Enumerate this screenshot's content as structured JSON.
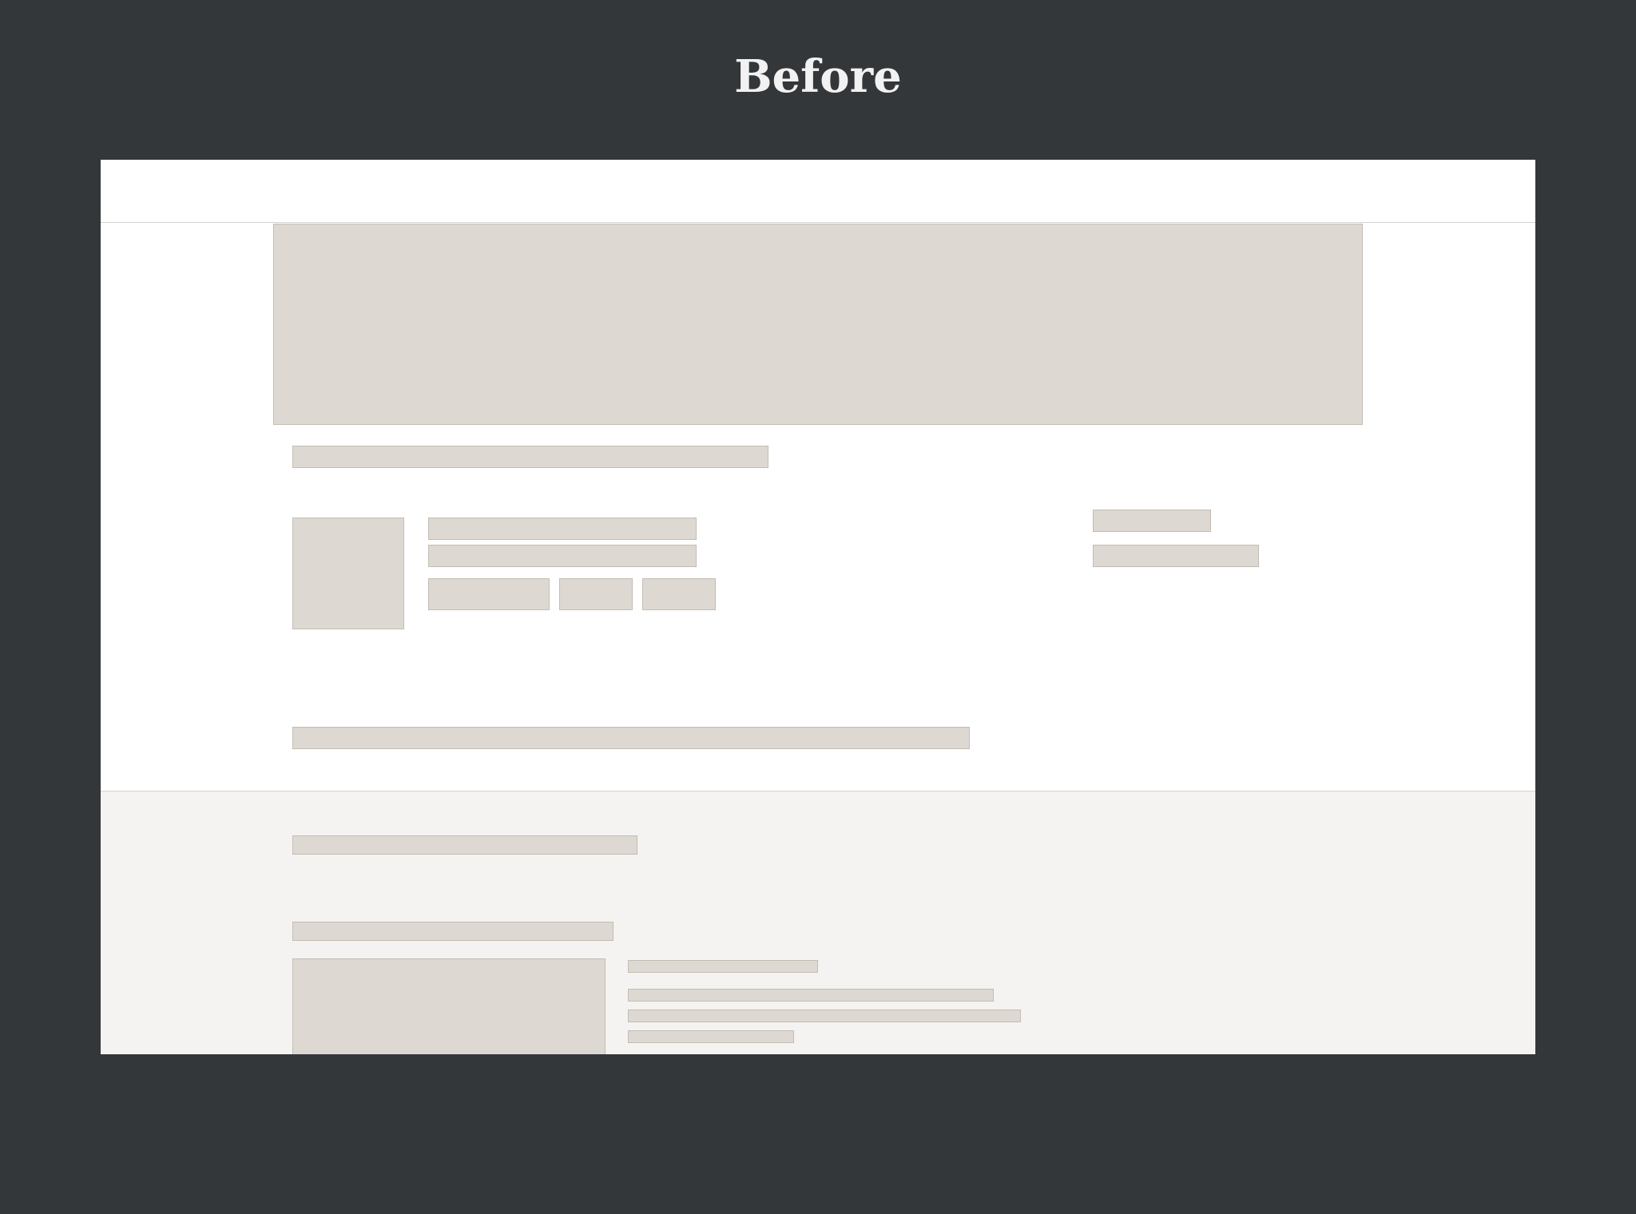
{
  "heading": "Before",
  "colors": {
    "backdrop": "#34373a",
    "page": "#ffffff",
    "lower_section": "#f4f3f1",
    "placeholder_fill": "#ddd8d1",
    "placeholder_border": "#c3bdb4"
  }
}
